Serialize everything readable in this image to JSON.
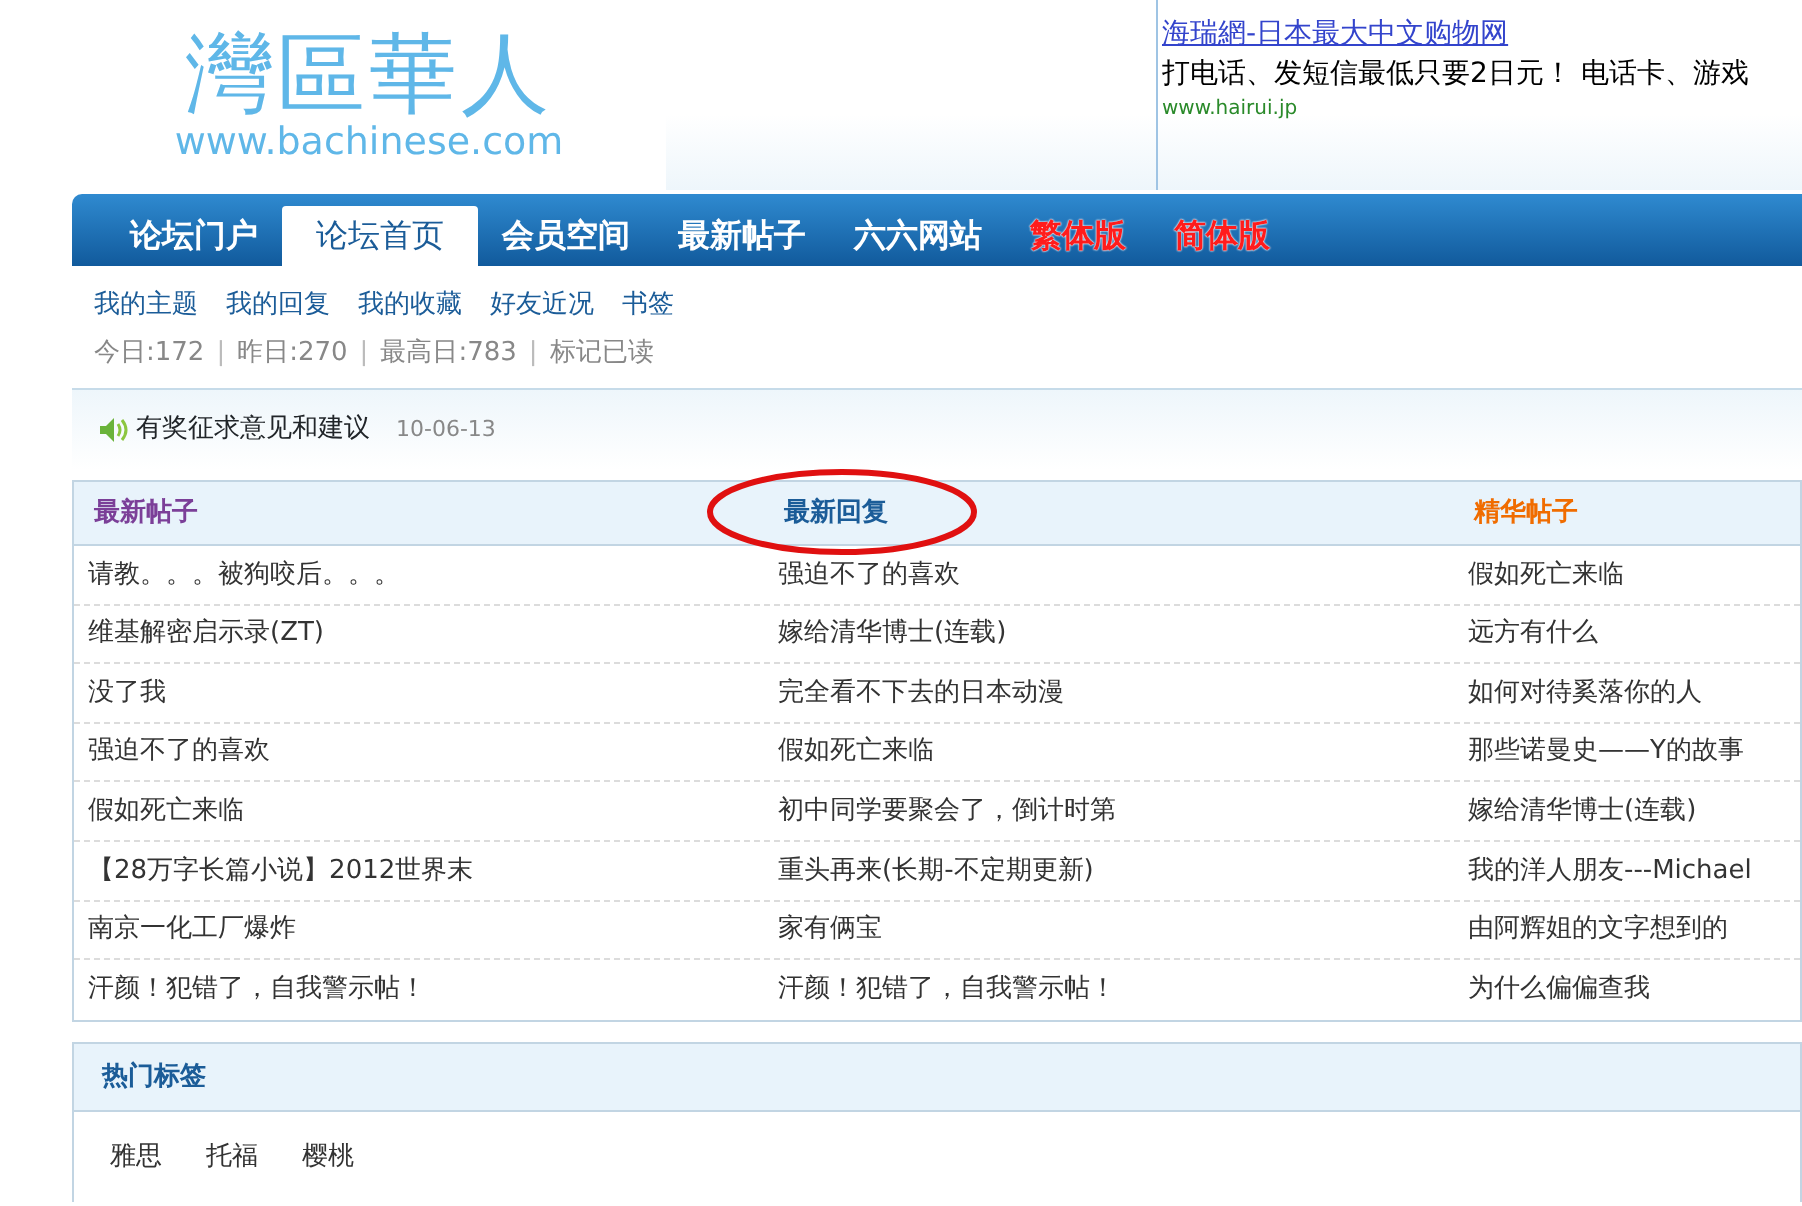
{
  "logo": {
    "title": "灣區華人",
    "url": "www.bachinese.com"
  },
  "ad": {
    "title": "海瑞網-日本最大中文购物网",
    "text": "打电话、发短信最低只要2日元！ 电话卡、游戏",
    "url": "www.hairui.jp"
  },
  "nav": [
    {
      "label": "论坛门户",
      "selected": false,
      "kind": "page"
    },
    {
      "label": "论坛首页",
      "selected": true,
      "kind": "page"
    },
    {
      "label": "会员空间",
      "selected": false,
      "kind": "page"
    },
    {
      "label": "最新帖子",
      "selected": false,
      "kind": "page"
    },
    {
      "label": "六六网站",
      "selected": false,
      "kind": "page"
    },
    {
      "label": "繁体版",
      "selected": false,
      "kind": "version"
    },
    {
      "label": "简体版",
      "selected": false,
      "kind": "version"
    }
  ],
  "user_links": [
    "我的主题",
    "我的回复",
    "我的收藏",
    "好友近况",
    "书签"
  ],
  "stats": [
    {
      "kind": "stat",
      "text": "今日:172"
    },
    {
      "kind": "separator",
      "text": "|"
    },
    {
      "kind": "stat",
      "text": "昨日:270"
    },
    {
      "kind": "separator",
      "text": "|"
    },
    {
      "kind": "stat",
      "text": "最高日:783"
    },
    {
      "kind": "separator",
      "text": "|"
    },
    {
      "kind": "link",
      "text": "标记已读"
    }
  ],
  "notice": {
    "text": "有奖征求意见和建议",
    "date": "10-06-13"
  },
  "columns": [
    {
      "title": "最新帖子",
      "color": "#7b3f98"
    },
    {
      "title": "最新回复",
      "color": "#1b5c98"
    },
    {
      "title": "精华帖子",
      "color": "#f06c00"
    }
  ],
  "rows": [
    [
      "请教。。。被狗咬后。。。",
      "强迫不了的喜欢",
      "假如死亡来临"
    ],
    [
      "维基解密启示录(ZT)",
      "嫁给清华博士(连载)",
      "远方有什么"
    ],
    [
      "没了我",
      "完全看不下去的日本动漫",
      "如何对待奚落你的人"
    ],
    [
      "强迫不了的喜欢",
      "假如死亡来临",
      "那些诺曼史——Y的故事"
    ],
    [
      "假如死亡来临",
      "初中同学要聚会了，倒计时第",
      "嫁给清华博士(连载)"
    ],
    [
      "【28万字长篇小说】2012世界末",
      "重头再来(长期-不定期更新)",
      "我的洋人朋友---Michael"
    ],
    [
      "南京一化工厂爆炸",
      "家有俩宝",
      "由阿辉姐的文字想到的"
    ],
    [
      "汗颜！犯错了，自我警示帖！",
      "汗颜！犯错了，自我警示帖！",
      "为什么偏偏查我"
    ]
  ],
  "hot_tags": {
    "title": "热门标签",
    "tags": [
      "雅思",
      "托福",
      "樱桃"
    ]
  }
}
